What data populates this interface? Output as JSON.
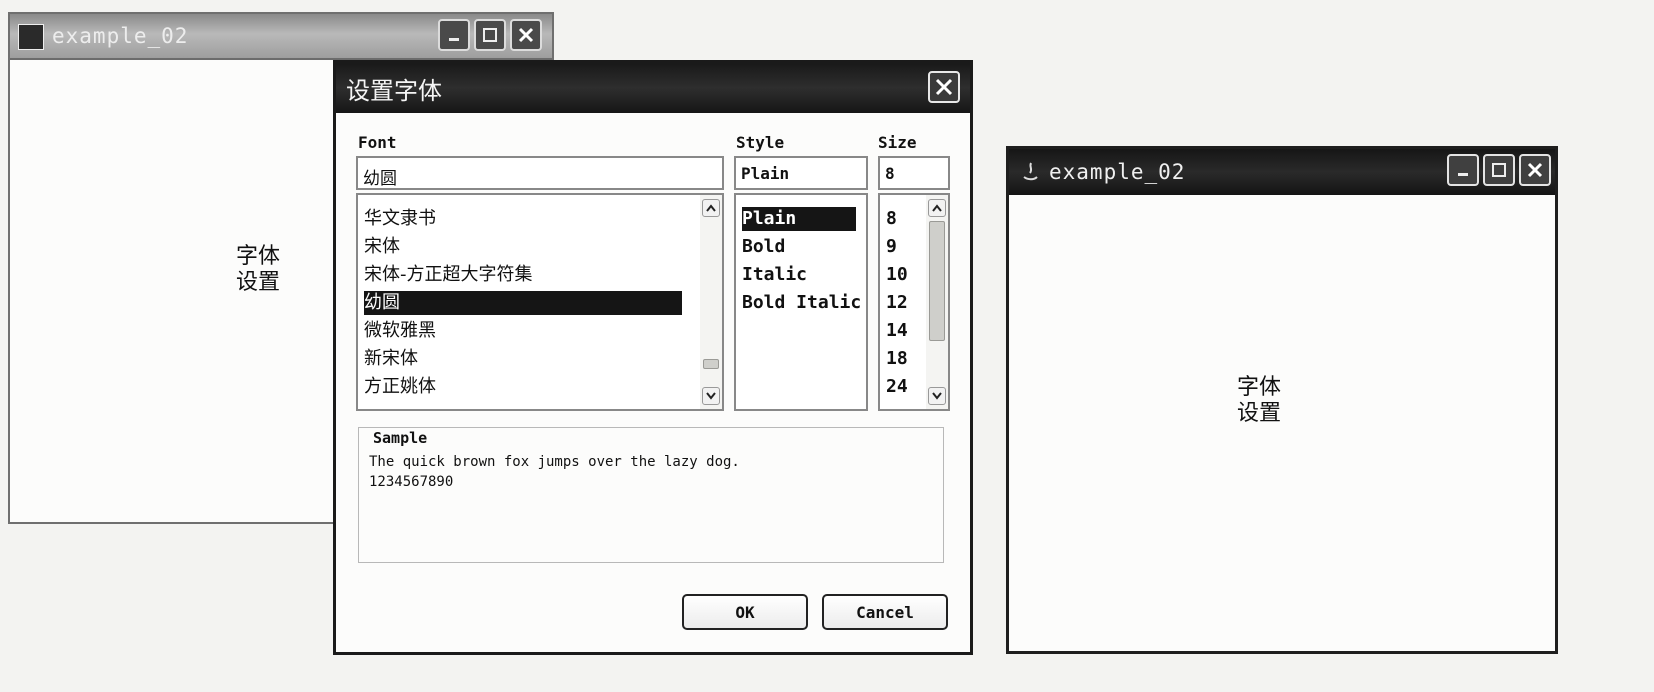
{
  "bg_window": {
    "title": "example_02",
    "label_line1": "字体",
    "label_line2": "设置"
  },
  "dialog": {
    "title": "设置字体",
    "font_label": "Font",
    "style_label": "Style",
    "size_label": "Size",
    "font_value": "幼圆",
    "style_value": "Plain",
    "size_value": "8",
    "fonts": [
      "华文隶书",
      "宋体",
      "宋体-方正超大字符集",
      "幼圆",
      "微软雅黑",
      "新宋体",
      "方正姚体"
    ],
    "selected_font": "幼圆",
    "styles": [
      "Plain",
      "Bold",
      "Italic",
      "Bold Italic"
    ],
    "selected_style": "Plain",
    "sizes": [
      "8",
      "9",
      "10",
      "12",
      "14",
      "18",
      "24"
    ],
    "selected_size": "8",
    "sample_label": "Sample",
    "sample_line1": "The quick brown fox jumps over the lazy dog.",
    "sample_line2": "1234567890",
    "ok_label": "OK",
    "cancel_label": "Cancel"
  },
  "right_window": {
    "title": "example_02",
    "label_line1": "字体",
    "label_line2": "设置"
  }
}
